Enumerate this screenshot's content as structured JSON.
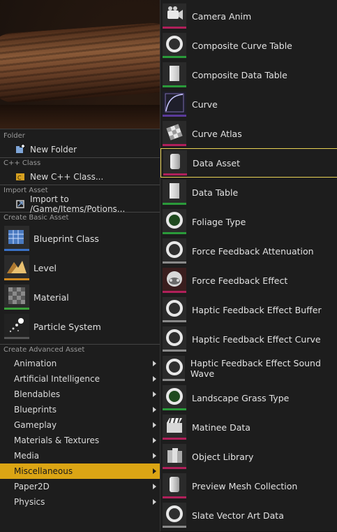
{
  "left_menu": {
    "sections": {
      "folder": "Folder",
      "cpp_class": "C++ Class",
      "import_asset": "Import Asset",
      "create_basic_asset": "Create Basic Asset",
      "create_advanced_asset": "Create Advanced Asset"
    },
    "new_folder": "New Folder",
    "new_cpp_class": "New C++ Class...",
    "import_to": "Import to /Game/Items/Potions...",
    "basic_assets": [
      "Blueprint Class",
      "Level",
      "Material",
      "Particle System"
    ],
    "advanced_categories": [
      "Animation",
      "Artificial Intelligence",
      "Blendables",
      "Blueprints",
      "Gameplay",
      "Materials & Textures",
      "Media",
      "Miscellaneous",
      "Paper2D",
      "Physics"
    ],
    "selected_category": "Miscellaneous"
  },
  "right_menu": {
    "items": [
      "Camera Anim",
      "Composite Curve Table",
      "Composite Data Table",
      "Curve",
      "Curve Atlas",
      "Data Asset",
      "Data Table",
      "Foliage Type",
      "Force Feedback Attenuation",
      "Force Feedback Effect",
      "Haptic Feedback Effect Buffer",
      "Haptic Feedback Effect Curve",
      "Haptic Feedback Effect Sound Wave",
      "Landscape Grass Type",
      "Matinee Data",
      "Object Library",
      "Preview Mesh Collection",
      "Slate Vector Art Data"
    ],
    "highlighted_item": "Data Asset",
    "icons": [
      "camera-anim-icon",
      "composite-curve-table-icon",
      "composite-data-table-icon",
      "curve-icon",
      "curve-atlas-icon",
      "data-asset-icon",
      "data-table-icon",
      "foliage-type-icon",
      "force-feedback-attenuation-icon",
      "force-feedback-effect-icon",
      "haptic-feedback-buffer-icon",
      "haptic-feedback-curve-icon",
      "haptic-feedback-sound-wave-icon",
      "landscape-grass-type-icon",
      "matinee-data-icon",
      "object-library-icon",
      "preview-mesh-collection-icon",
      "slate-vector-art-data-icon"
    ]
  },
  "colors": {
    "selected_category": "#dba514",
    "highlight_border": "#e8d255",
    "blueprint_accent": "#3a72c8",
    "level_accent": "#d08a20",
    "material_accent": "#3aa03a",
    "misc_magenta": "#b0205a",
    "misc_green": "#2a9a3a",
    "misc_gray": "#8a8a8a",
    "curve_purple": "#5a3a9a"
  }
}
